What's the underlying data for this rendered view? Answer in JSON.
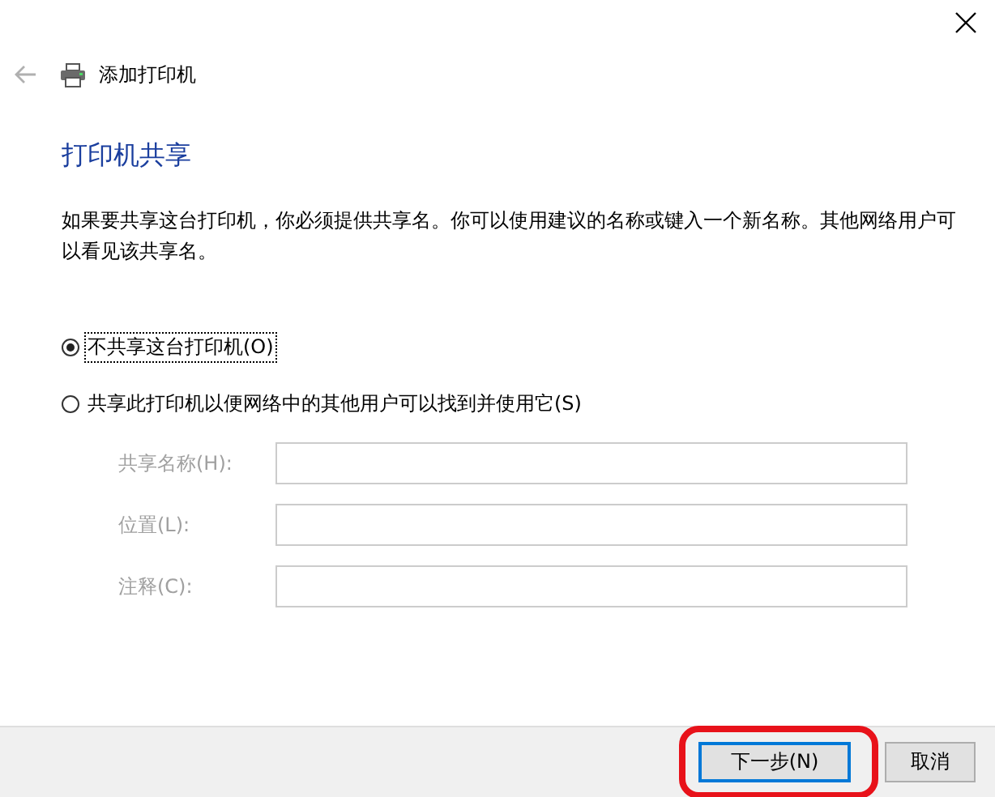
{
  "window": {
    "title": "添加打印机"
  },
  "heading": "打印机共享",
  "description": "如果要共享这台打印机，你必须提供共享名。你可以使用建议的名称或键入一个新名称。其他网络用户可以看见该共享名。",
  "options": [
    {
      "label": "不共享这台打印机(O)",
      "selected": true,
      "focused": true
    },
    {
      "label": "共享此打印机以便网络中的其他用户可以找到并使用它(S)",
      "selected": false,
      "focused": false
    }
  ],
  "fields": [
    {
      "label": "共享名称(H):",
      "disabled": true
    },
    {
      "label": "位置(L):",
      "disabled": true
    },
    {
      "label": "注释(C):",
      "disabled": true
    }
  ],
  "buttons": [
    {
      "label": "下一步(N)",
      "default": true,
      "highlighted": true
    },
    {
      "label": "取消",
      "default": false,
      "highlighted": false
    }
  ]
}
